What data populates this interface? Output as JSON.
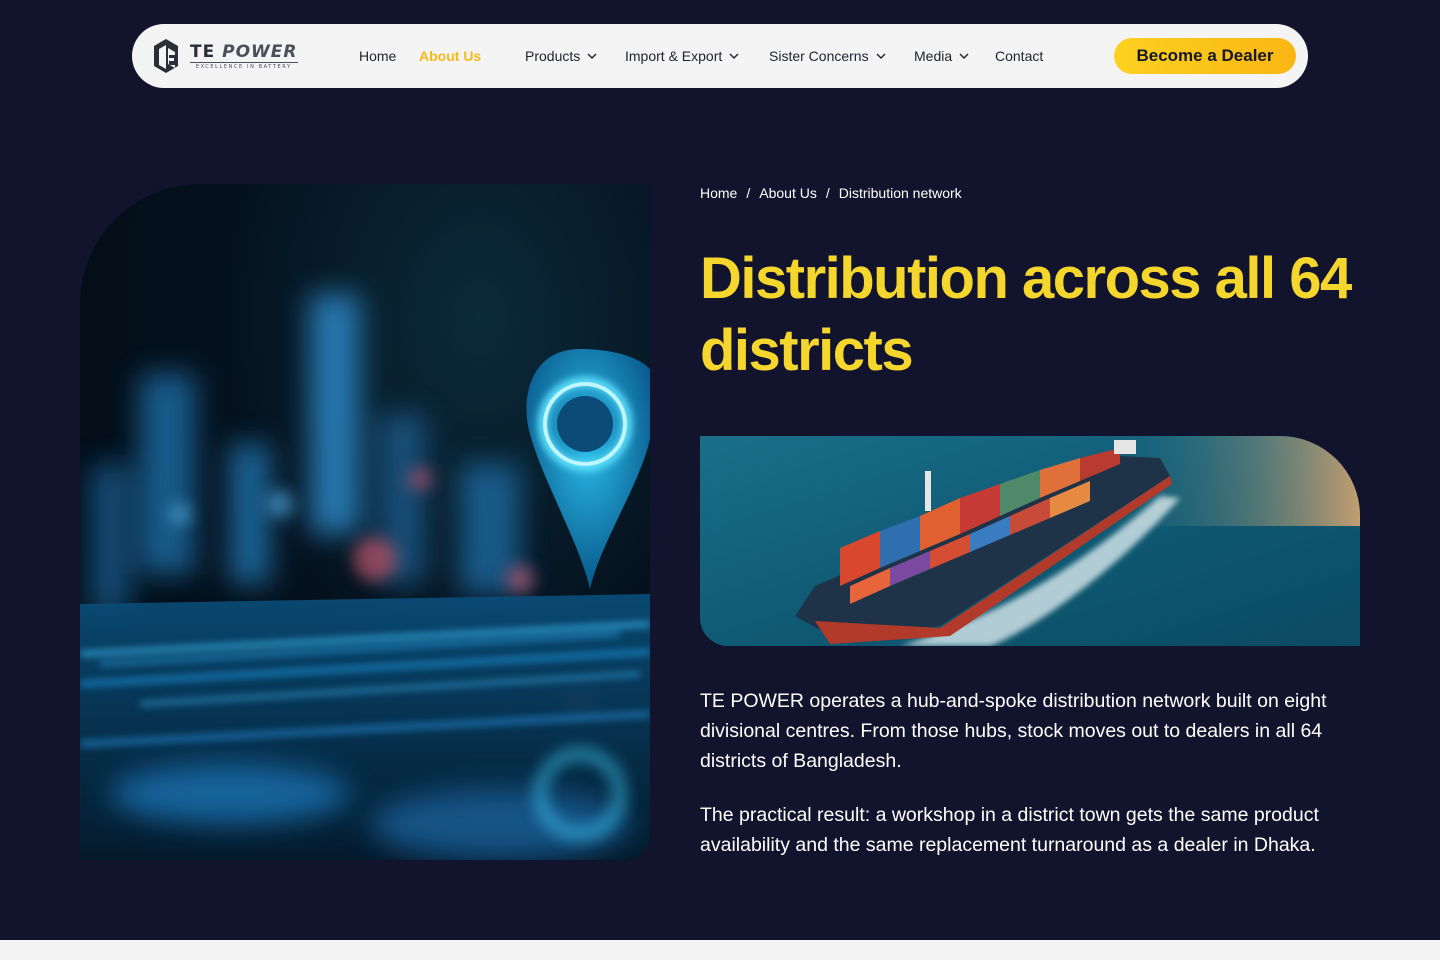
{
  "brand": {
    "name_part1": "TE",
    "name_part2": "POWER",
    "tagline": "EXCELLENCE IN BATTERY"
  },
  "nav": {
    "items": [
      {
        "label": "Home",
        "active": false,
        "dropdown": false
      },
      {
        "label": "About Us",
        "active": true,
        "dropdown": false
      },
      {
        "label": "Products",
        "active": false,
        "dropdown": true
      },
      {
        "label": "Import & Export",
        "active": false,
        "dropdown": true
      },
      {
        "label": "Sister Concerns",
        "active": false,
        "dropdown": true
      },
      {
        "label": "Media",
        "active": false,
        "dropdown": true
      },
      {
        "label": "Contact",
        "active": false,
        "dropdown": false
      }
    ],
    "cta_label": "Become a Dealer"
  },
  "breadcrumb": {
    "items": [
      "Home",
      "About Us",
      "Distribution network"
    ],
    "separator": "/"
  },
  "hero": {
    "title": "Distribution across all 64 districts",
    "paragraphs": [
      "TE POWER operates a hub-and-spoke distribution network built on eight divisional centres. From those hubs, stock moves out to dealers in all 64 districts of Bangladesh.",
      "The practical result: a workshop in a district town gets the same product availability and the same replacement turnaround as a dealer in Dhaka."
    ]
  },
  "colors": {
    "background": "#12142d",
    "accent_yellow": "#f5d62d",
    "active_nav": "#f5b816",
    "navbar_bg": "#f4f4f5"
  }
}
